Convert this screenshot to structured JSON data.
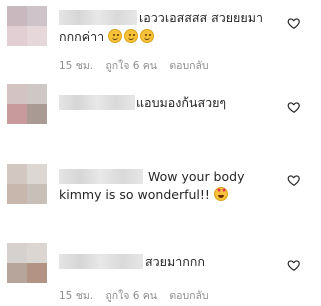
{
  "comments": [
    {
      "avatar_colors": [
        "#c9b9bf",
        "#cdc3c8",
        "#e2cfd3",
        "#e6d7db"
      ],
      "text_line1": "เอววเอสสสส สวยยยมา",
      "text_line2": "กกกค่าา",
      "emoji": [
        "smile-emoji",
        "smile-emoji",
        "smile-emoji"
      ],
      "time": "15 ชม.",
      "likes": "ถูกใจ 6 คน",
      "reply": "ตอบกลับ"
    },
    {
      "avatar_colors": [
        "#d3c3c3",
        "#cfc7c6",
        "#c99a9c",
        "#a99b93"
      ],
      "text_line1": "แอบมองก้นสวยๆ",
      "text_line2": "",
      "emoji": [],
      "time": "",
      "likes": "",
      "reply": ""
    },
    {
      "avatar_colors": [
        "#d2c8c1",
        "#ddd7d3",
        "#c7b7ac",
        "#c8bfb8"
      ],
      "text_line1": "Wow your body",
      "text_line2": "kimmy is so wonderful!!",
      "emoji": [
        "star-struck-emoji"
      ],
      "time": "",
      "likes": "",
      "reply": ""
    },
    {
      "avatar_colors": [
        "#d6d0ce",
        "#dcd6d2",
        "#b7a59b",
        "#b39484"
      ],
      "text_line1": "สวยมากกก",
      "text_line2": "",
      "emoji": [],
      "time": "15 ชม.",
      "likes": "ถูกใจ 6 คน",
      "reply": "ตอบกลับ"
    }
  ],
  "colors": {
    "text": "#262626",
    "meta": "#8e8e8e",
    "heart_outline": "#262626"
  },
  "icons": {
    "like": "heart-outline-icon"
  }
}
